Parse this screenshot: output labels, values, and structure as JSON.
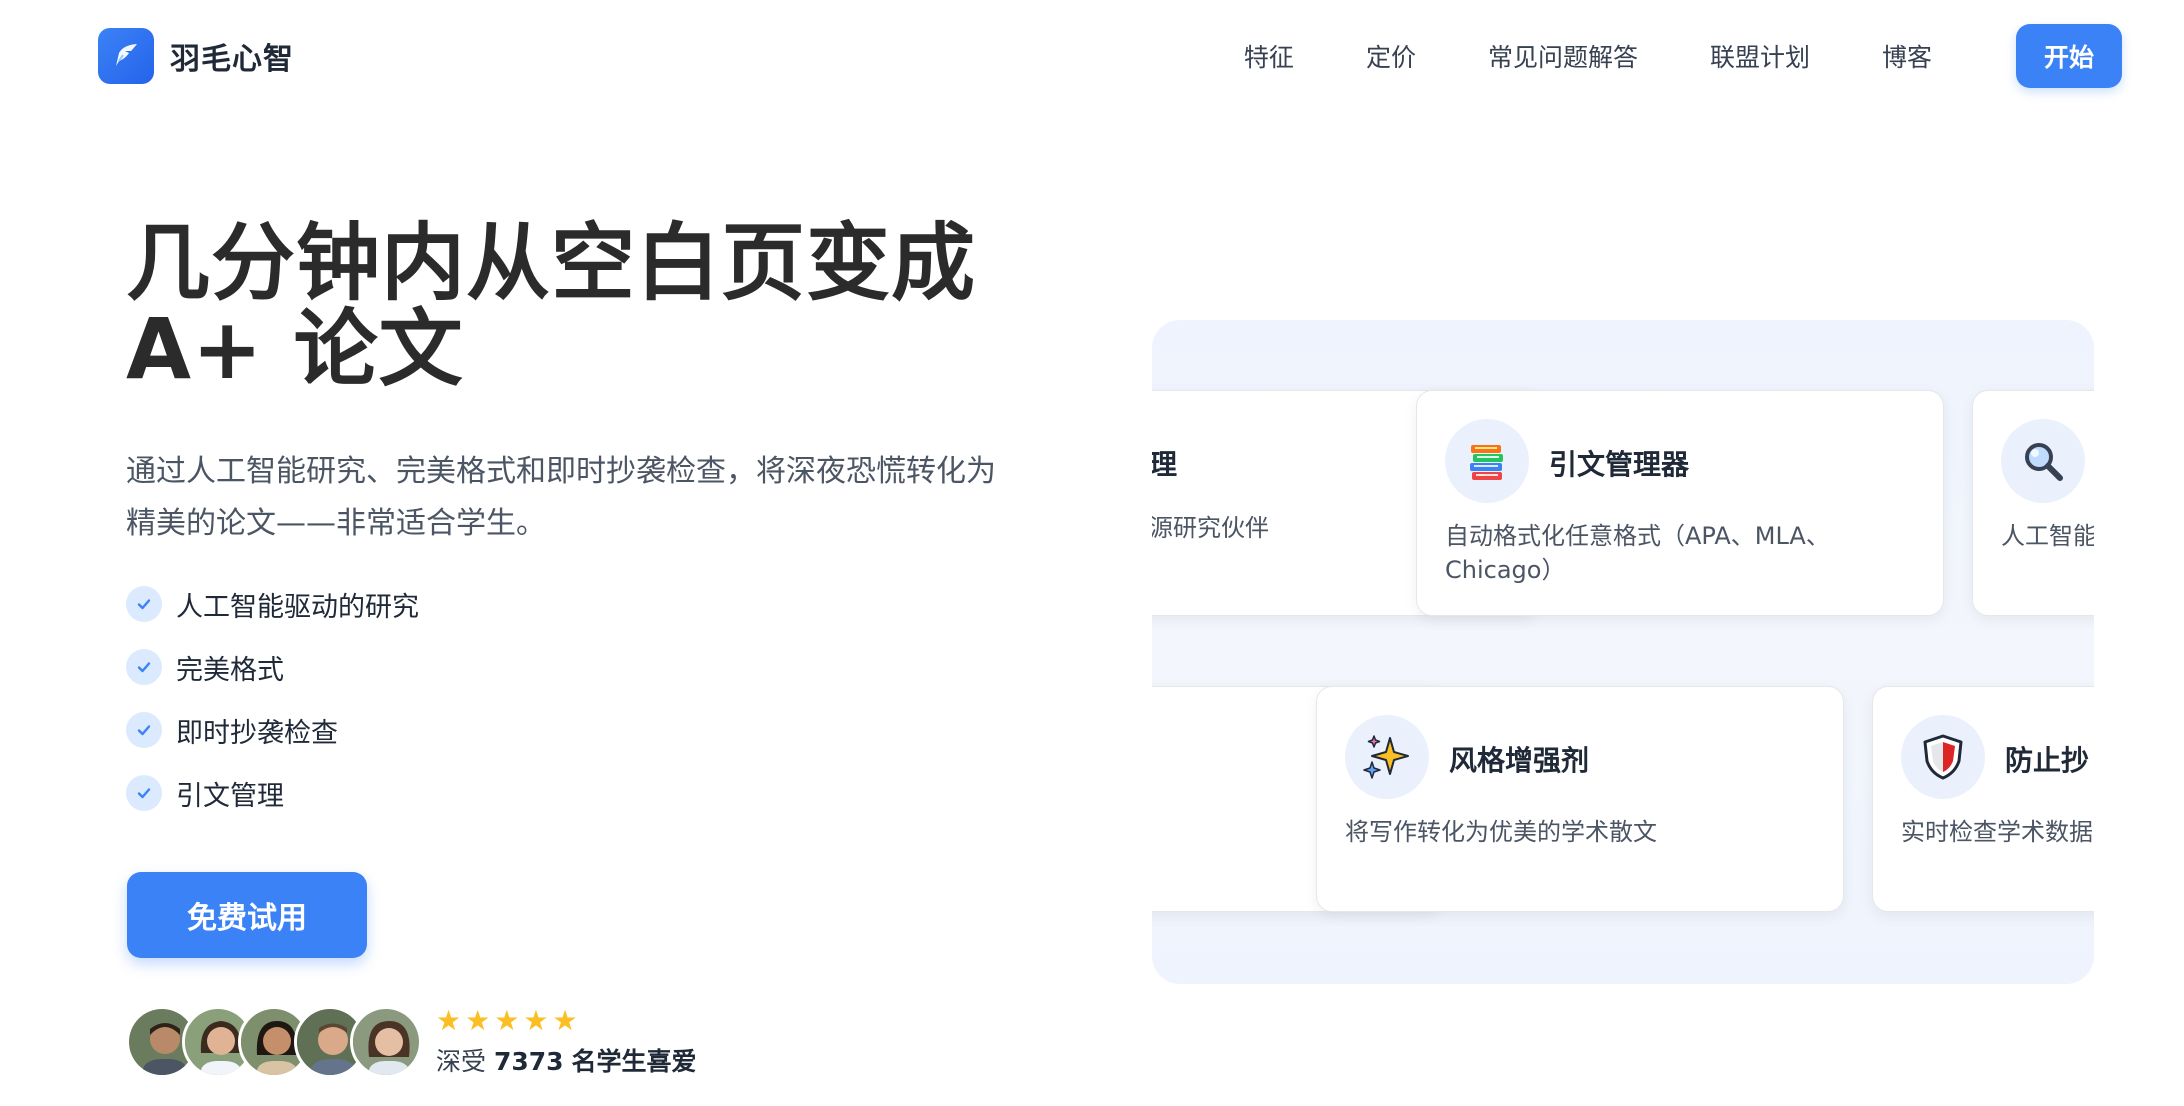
{
  "brand": {
    "name": "羽毛心智",
    "accent": "#3b82f6"
  },
  "nav": {
    "links": [
      "特征",
      "定价",
      "常见问题解答",
      "联盟计划",
      "博客"
    ],
    "cta": "开始"
  },
  "hero": {
    "headline_line1": "几分钟内从空白页变成",
    "headline_line2": "A+ 论文",
    "subtitle_line1": "通过人工智能研究、完美格式和即时抄袭检查，将深夜恐慌转化为",
    "subtitle_line2": "精美的论文——非常适合学生。",
    "features": [
      "人工智能驱动的研究",
      "完美格式",
      "即时抄袭检查",
      "引文管理"
    ],
    "cta": "免费试用",
    "rating_stars": 5,
    "social_prefix": "深受",
    "social_count": "7373",
    "social_suffix": "名学生喜爱"
  },
  "cards": {
    "row1": [
      {
        "title": "理",
        "desc": "源研究伙伴",
        "icon": "partial-icon"
      },
      {
        "title": "引文管理器",
        "desc": "自动格式化任意格式（APA、MLA、Chicago）",
        "icon": "books-icon"
      },
      {
        "title": "",
        "desc": "人工智能",
        "icon": "magnifier-icon"
      }
    ],
    "row2": [
      {
        "title": "风格增强剂",
        "desc": "将写作转化为优美的学术散文",
        "icon": "sparkles-icon"
      },
      {
        "title": "防止抄",
        "desc": "实时检查学术数据",
        "icon": "shield-icon"
      }
    ]
  }
}
